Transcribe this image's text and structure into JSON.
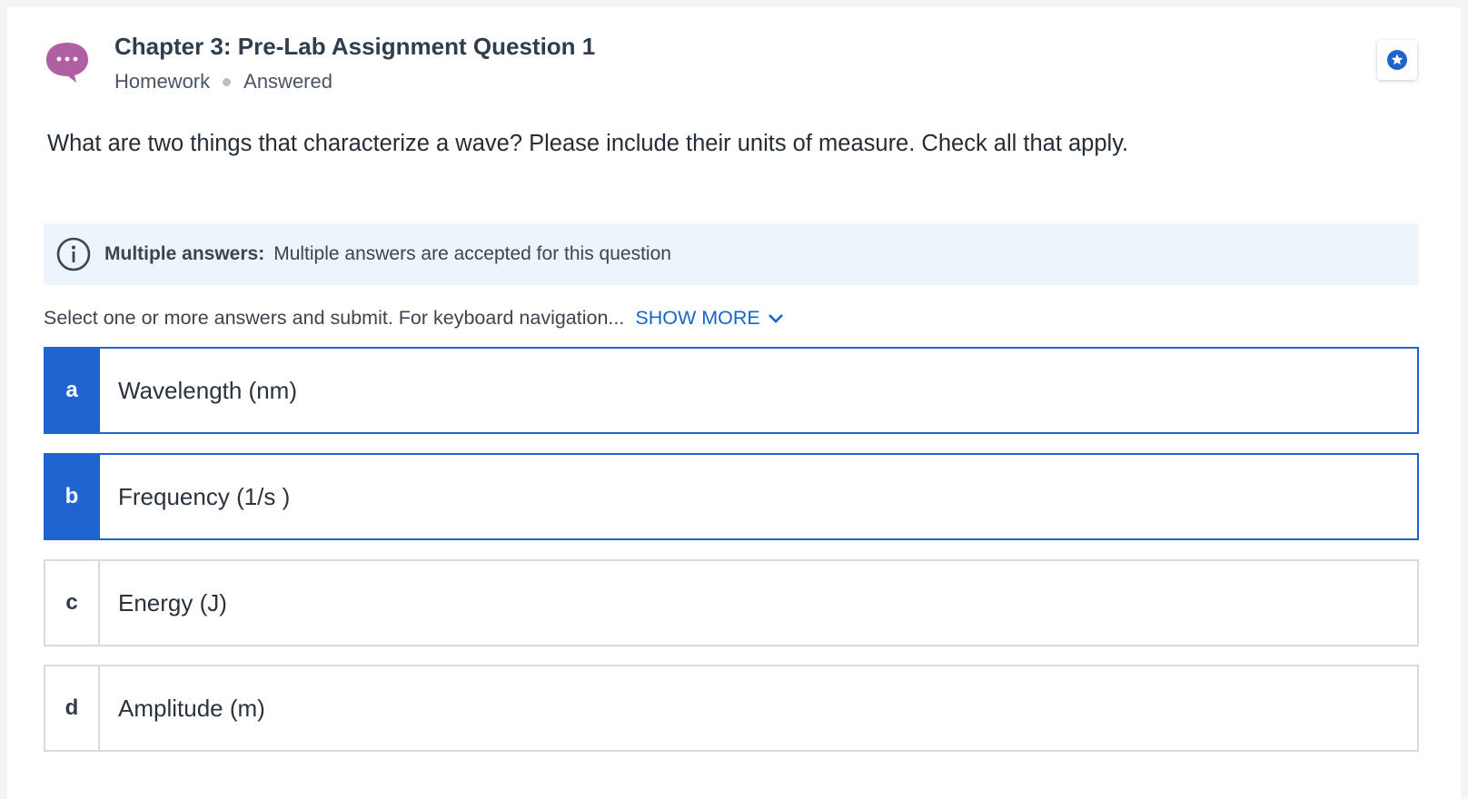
{
  "header": {
    "title": "Chapter 3: Pre-Lab Assignment Question 1",
    "category": "Homework",
    "status": "Answered",
    "icon_color": "#b05fa3",
    "bookmark_icon": "star-icon"
  },
  "question": {
    "text": "What are two things that characterize a wave? Please include their units of measure. Check all that apply."
  },
  "info": {
    "label": "Multiple answers:",
    "text": "Multiple answers are accepted for this question"
  },
  "instructions": {
    "text": "Select one or more answers and submit. For keyboard navigation...",
    "show_more": "SHOW MORE"
  },
  "options": [
    {
      "letter": "a",
      "text": "Wavelength (nm)",
      "selected": true
    },
    {
      "letter": "b",
      "text": "Frequency (1/s )",
      "selected": true
    },
    {
      "letter": "c",
      "text": "Energy (J)",
      "selected": false
    },
    {
      "letter": "d",
      "text": "Amplitude (m)",
      "selected": false
    }
  ],
  "colors": {
    "accent": "#1f63d0",
    "link": "#1565c9",
    "banner_bg": "#edf5fc"
  }
}
